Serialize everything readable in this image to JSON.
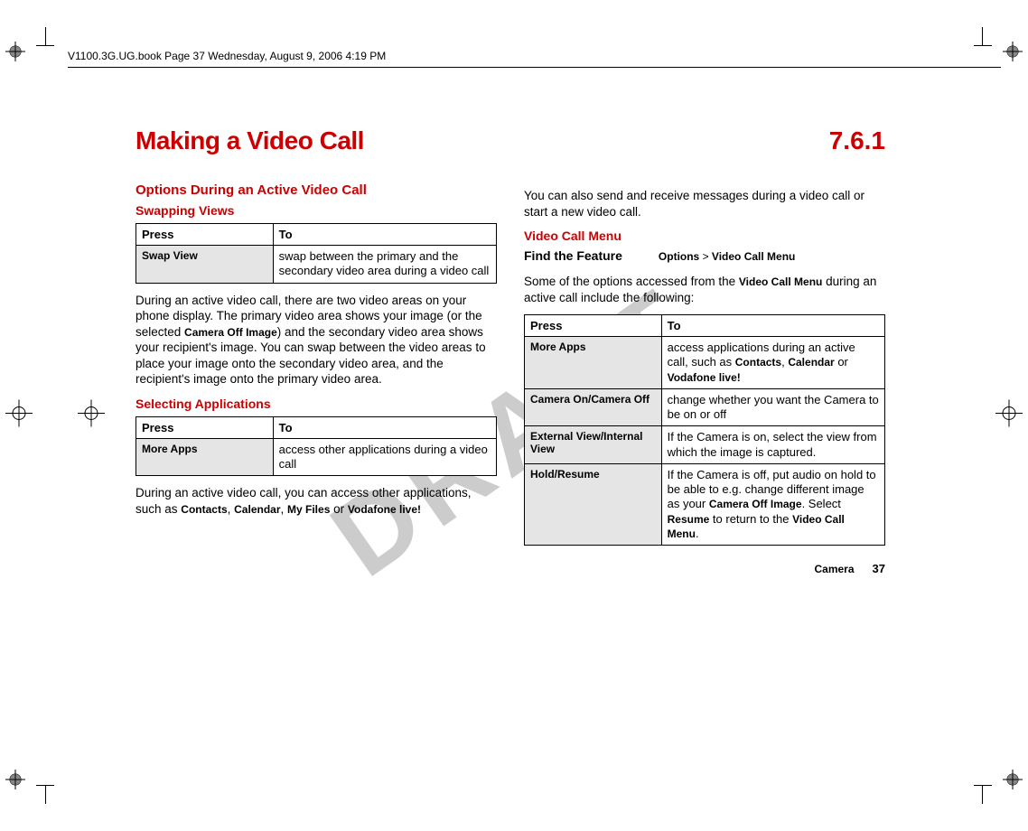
{
  "print_header": "V1100.3G.UG.book  Page 37  Wednesday, August 9, 2006  4:19 PM",
  "watermark": "DRAFT",
  "heading": {
    "title": "Making a Video Call",
    "number": "7.6.1"
  },
  "left": {
    "section": "Options During an Active Video Call",
    "swap": {
      "title": "Swapping Views",
      "th_press": "Press",
      "th_to": "To",
      "row_press": "Swap View",
      "row_to": "swap between the primary and the secondary video area during a video call"
    },
    "para1_a": "During an active video call, there are two video areas on your phone display. The primary video area shows your image (or the selected ",
    "para1_b": "Camera Off Image",
    "para1_c": ") and the secondary video area shows your recipient's image. You can swap between the video areas to place your image onto the secondary video area, and the recipient's image onto the primary video area.",
    "select": {
      "title": "Selecting Applications",
      "th_press": "Press",
      "th_to": "To",
      "row_press": "More Apps",
      "row_to": "access other applications during a video call"
    },
    "para2_a": "During an active video call, you can access other applications, such as ",
    "para2_b": "Contacts",
    "para2_c": ", ",
    "para2_d": "Calendar",
    "para2_e": ", ",
    "para2_f": "My Files",
    "para2_g": " or ",
    "para2_h": "Vodafone live!"
  },
  "right": {
    "intro": "You can also send and receive messages during a video call or start a new video call.",
    "vcm_title": "Video Call Menu",
    "find_label": "Find the Feature",
    "find_a": "Options",
    "find_b": " > ",
    "find_c": "Video Call Menu",
    "intro2_a": "Some of the options accessed from the ",
    "intro2_b": "Video Call Menu",
    "intro2_c": " during an active call include the following:",
    "table": {
      "th_press": "Press",
      "th_to": "To",
      "r1_press": "More Apps",
      "r1_to_a": "access applications during an active call, such as ",
      "r1_to_b": "Contacts",
      "r1_to_c": ", ",
      "r1_to_d": "Calendar",
      "r1_to_e": " or ",
      "r1_to_f": "Vodafone live!",
      "r2_press": "Camera On/Camera Off",
      "r2_to": "change whether you want the Camera to be on or off",
      "r3_press": "External View/Internal View",
      "r3_to": "If the Camera is on, select the view from which the image is captured.",
      "r4_press": "Hold/Resume",
      "r4_to_a": "If the Camera is off, put audio on hold to be able to e.g. change different image as your ",
      "r4_to_b": "Camera Off Image",
      "r4_to_c": ". Select ",
      "r4_to_d": "Resume",
      "r4_to_e": " to return to the ",
      "r4_to_f": "Video Call Menu",
      "r4_to_g": "."
    }
  },
  "footer": {
    "section": "Camera",
    "page": "37"
  }
}
